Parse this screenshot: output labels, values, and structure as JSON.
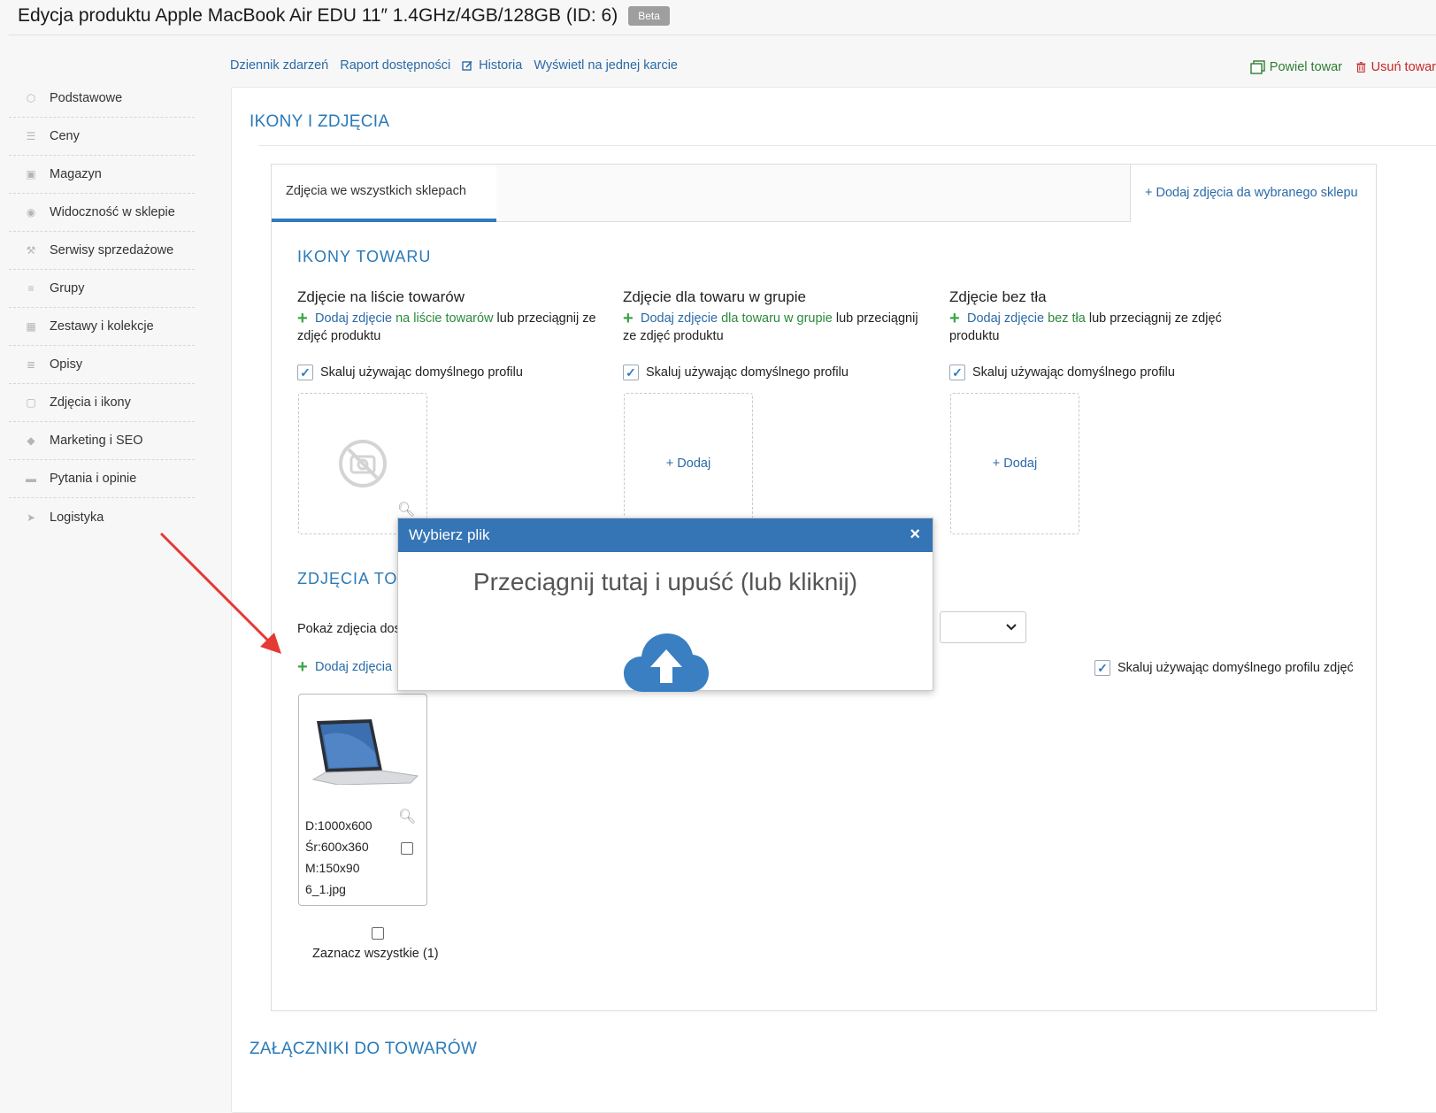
{
  "header": {
    "title": "Edycja produktu Apple MacBook Air EDU 11″ 1.4GHz/4GB/128GB (ID: 6)",
    "badge": "Beta"
  },
  "toplinks": {
    "journal": "Dziennik zdarzeń",
    "availability": "Raport dostępności",
    "history": "Historia",
    "single_card": "Wyświetl na jednej karcie"
  },
  "actions": {
    "duplicate": "Powiel towar",
    "delete": "Usuń towar"
  },
  "sidebar": {
    "items": [
      {
        "label": "Podstawowe",
        "icon": "cube-icon"
      },
      {
        "label": "Ceny",
        "icon": "money-icon"
      },
      {
        "label": "Magazyn",
        "icon": "box-icon"
      },
      {
        "label": "Widoczność w sklepie",
        "icon": "eye-icon"
      },
      {
        "label": "Serwisy sprzedażowe",
        "icon": "hammer-icon"
      },
      {
        "label": "Grupy",
        "icon": "layers-icon"
      },
      {
        "label": "Zestawy i kolekcje",
        "icon": "grid-icon"
      },
      {
        "label": "Opisy",
        "icon": "lines-icon"
      },
      {
        "label": "Zdjęcia i ikony",
        "icon": "camera-icon"
      },
      {
        "label": "Marketing i SEO",
        "icon": "tag-icon"
      },
      {
        "label": "Pytania i opinie",
        "icon": "chat-icon"
      },
      {
        "label": "Logistyka",
        "icon": "plane-icon"
      }
    ]
  },
  "main": {
    "section_title": "IKONY I ZDJĘCIA",
    "tabs": {
      "active": "Zdjęcia we wszystkich sklepach",
      "add_shop": "+ Dodaj zdjęcia da wybranego sklepu"
    },
    "icons_title": "IKONY TOWARU",
    "columns": [
      {
        "title": "Zdjęcie na liście towarów",
        "add": "Dodaj zdjęcie",
        "ctx": "na liście towarów",
        "line1_rest": "lub przeciągnij ze",
        "line2": "zdjęć produktu",
        "scale": "Skaluj używając domyślnego profilu"
      },
      {
        "title": "Zdjęcie dla towaru w grupie",
        "add": "Dodaj zdjęcie",
        "ctx": "dla towaru w grupie",
        "line1_rest": "lub przeciągnij",
        "line2": "ze zdjęć produktu",
        "scale": "Skaluj używając domyślnego profilu"
      },
      {
        "title": "Zdjęcie bez tła",
        "add": "Dodaj zdjęcie",
        "ctx": "bez tła",
        "line1_rest": "lub przeciągnij ze zdjęć",
        "line2": "produktu",
        "scale": "Skaluj używając domyślnego profilu"
      }
    ],
    "add_label": "+ Dodaj",
    "photos_title": "ZDJĘCIA TOW",
    "show_photos": "Pokaż zdjęcia dost",
    "add_photos": "Dodaj zdjęcia",
    "scale_photos": "Skaluj używając domyślnego profilu zdjęć",
    "photo": {
      "d": "D:1000x600",
      "sr": "Śr:600x360",
      "m": "M:150x90",
      "file": "6_1.jpg"
    },
    "select_all": "Zaznacz wszystkie (1)",
    "attachments_title": "ZAŁĄCZNIKI DO TOWARÓW"
  },
  "modal": {
    "title": "Wybierz plik",
    "close": "×",
    "drop_text": "Przeciągnij tutaj i upuść (lub kliknij)"
  },
  "colors": {
    "accent": "#2e7bbf",
    "modal_header": "#3575b5",
    "green": "#3aa548",
    "red_arrow": "#e53935"
  }
}
